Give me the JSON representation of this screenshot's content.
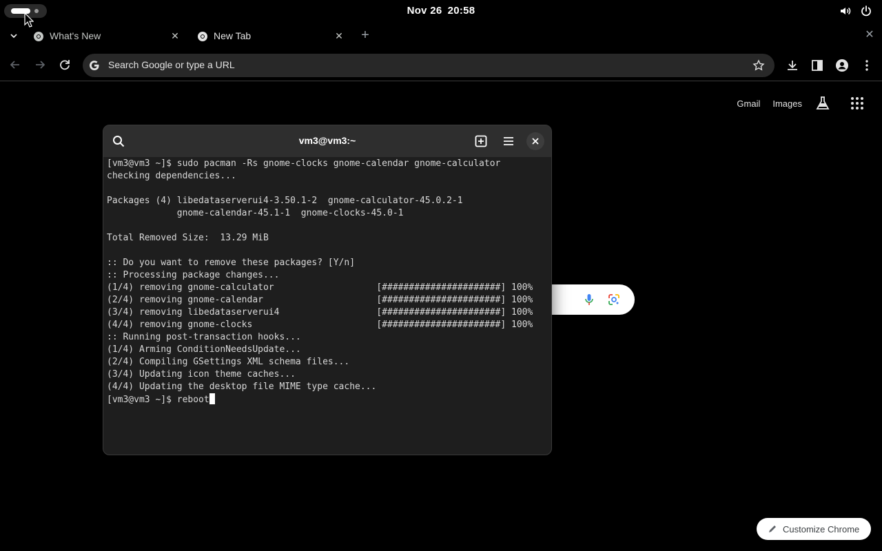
{
  "topbar": {
    "date": "Nov 26",
    "time": "20:58",
    "icons": [
      "volume-icon",
      "power-icon"
    ]
  },
  "browser": {
    "tabs": [
      {
        "title": "What's New",
        "active": false
      },
      {
        "title": "New Tab",
        "active": true
      }
    ],
    "omnibox_placeholder": "Search Google or type a URL"
  },
  "ntp": {
    "gmail": "Gmail",
    "images": "Images",
    "customize": "Customize Chrome"
  },
  "terminal": {
    "title": "vm3@vm3:~",
    "lines": [
      "[vm3@vm3 ~]$ sudo pacman -Rs gnome-clocks gnome-calendar gnome-calculator",
      "checking dependencies...",
      "",
      "Packages (4) libedataserverui4-3.50.1-2  gnome-calculator-45.0.2-1",
      "             gnome-calendar-45.1-1  gnome-clocks-45.0-1",
      "",
      "Total Removed Size:  13.29 MiB",
      "",
      ":: Do you want to remove these packages? [Y/n]",
      ":: Processing package changes...",
      "(1/4) removing gnome-calculator                   [######################] 100%",
      "(2/4) removing gnome-calendar                     [######################] 100%",
      "(3/4) removing libedataserverui4                  [######################] 100%",
      "(4/4) removing gnome-clocks                       [######################] 100%",
      ":: Running post-transaction hooks...",
      "(1/4) Arming ConditionNeedsUpdate...",
      "(2/4) Compiling GSettings XML schema files...",
      "(3/4) Updating icon theme caches...",
      "(4/4) Updating the desktop file MIME type cache..."
    ],
    "prompt": "[vm3@vm3 ~]$ ",
    "current_input": "reboot"
  }
}
